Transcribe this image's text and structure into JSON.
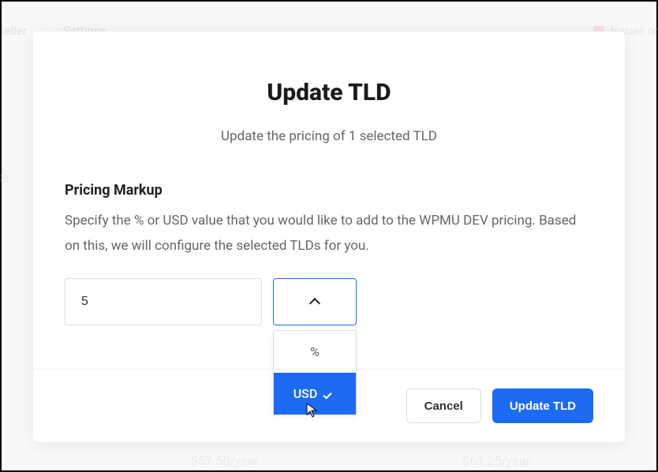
{
  "background": {
    "nav_item_1": "eseller",
    "nav_item_2": "Settings",
    "issues_label": "Issues or S",
    "tlds_label": ".Ds",
    "price_left": "$57.50/year",
    "price_right": "$63.25/year"
  },
  "modal": {
    "title": "Update TLD",
    "subtitle": "Update the pricing of 1 selected TLD",
    "section_title": "Pricing Markup",
    "section_description": "Specify the % or USD value that you would like to add to the WPMU DEV pricing. Based on this, we will configure the selected TLDs for you.",
    "markup_value": "5",
    "unit_options": {
      "percent": "%",
      "usd": "USD"
    },
    "selected_unit": "USD",
    "cancel_label": "Cancel",
    "submit_label": "Update TLD"
  }
}
